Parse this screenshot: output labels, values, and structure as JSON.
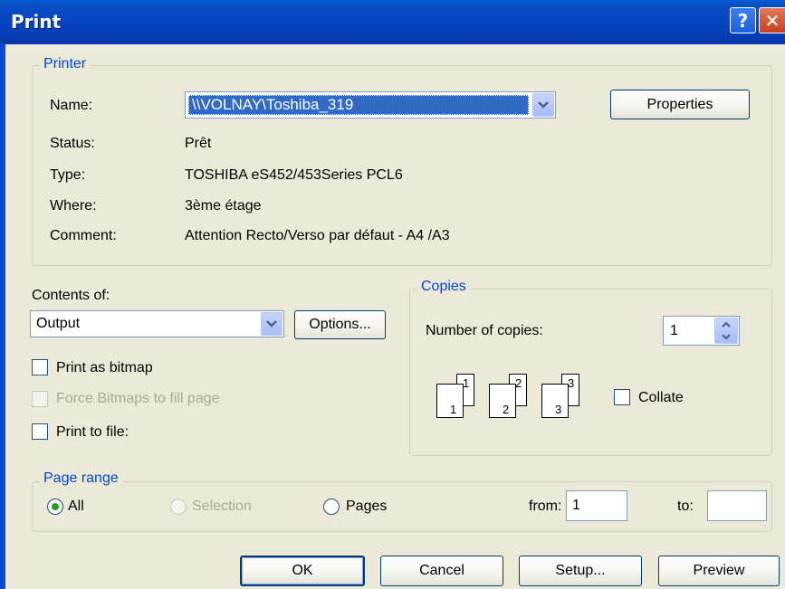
{
  "window": {
    "title": "Print",
    "help_glyph": "?",
    "close_glyph": "✕"
  },
  "printer": {
    "group_title": "Printer",
    "name_label": "Name:",
    "name_value": "\\\\VOLNAY\\Toshiba_319",
    "properties_label": "Properties",
    "status_label": "Status:",
    "status_value": "Prêt",
    "type_label": "Type:",
    "type_value": "TOSHIBA eS452/453Series PCL6",
    "where_label": "Where:",
    "where_value": "3ème étage",
    "comment_label": "Comment:",
    "comment_value": "Attention Recto/Verso par défaut - A4 /A3"
  },
  "contents": {
    "label": "Contents of:",
    "value": "Output",
    "options_label": "Options...",
    "print_as_bitmap": {
      "label": "Print as bitmap",
      "checked": false
    },
    "force_bitmaps": {
      "label": "Force Bitmaps to fill page",
      "checked": false,
      "enabled": false
    },
    "print_to_file": {
      "label": "Print to file:",
      "checked": false
    }
  },
  "copies": {
    "group_title": "Copies",
    "number_label": "Number of copies:",
    "number_value": "1",
    "collate_label": "Collate",
    "collate_checked": false,
    "collate_pages": [
      {
        "back": "1",
        "front": "1"
      },
      {
        "back": "2",
        "front": "2"
      },
      {
        "back": "3",
        "front": "3"
      }
    ]
  },
  "page_range": {
    "group_title": "Page range",
    "all_label": "All",
    "selection_label": "Selection",
    "pages_label": "Pages",
    "selected": "All",
    "from_label": "from:",
    "from_value": "1",
    "to_label": "to:",
    "to_value": ""
  },
  "buttons": {
    "ok": "OK",
    "cancel": "Cancel",
    "setup": "Setup...",
    "preview": "Preview"
  },
  "colors": {
    "titlebar": "#0746c4",
    "group_title": "#0046d5",
    "dialog_bg": "#ECE9D8",
    "selection": "#316ac5"
  }
}
